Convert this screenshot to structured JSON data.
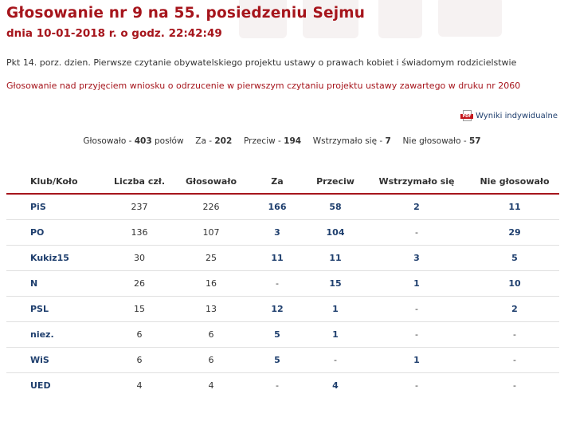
{
  "header": {
    "title": "Głosowanie nr 9 na 55. posiedzeniu Sejmu",
    "subtitle": "dnia 10-01-2018 r. o godz. 22:42:49"
  },
  "agenda": "Pkt 14. porz. dzien. Pierwsze czytanie obywatelskiego projektu ustawy o prawach kobiet i świadomym rodzicielstwie",
  "motion": "Głosowanie nad przyjęciem wniosku o odrzucenie w pierwszym czytaniu projektu ustawy zawartego w druku nr 2060",
  "individual_results": {
    "icon": "pdf-icon",
    "icon_text": "PDF",
    "label": "Wyniki indywidualne"
  },
  "summary": {
    "voted_label": "Głosowało -",
    "voted_value": "403",
    "voted_unit": "posłów",
    "za_label": "Za -",
    "za_value": "202",
    "przeciw_label": "Przeciw -",
    "przeciw_value": "194",
    "wstrz_label": "Wstrzymało się -",
    "wstrz_value": "7",
    "nieg_label": "Nie głosowało -",
    "nieg_value": "57"
  },
  "table": {
    "columns": [
      "Klub/Koło",
      "Liczba czł.",
      "Głosowało",
      "Za",
      "Przeciw",
      "Wstrzymało się",
      "Nie głosowało"
    ],
    "rows": [
      {
        "club": "PiS",
        "members": "237",
        "voted": "226",
        "za": "166",
        "przeciw": "58",
        "wstrz": "2",
        "nieg": "11"
      },
      {
        "club": "PO",
        "members": "136",
        "voted": "107",
        "za": "3",
        "przeciw": "104",
        "wstrz": "-",
        "nieg": "29"
      },
      {
        "club": "Kukiz15",
        "members": "30",
        "voted": "25",
        "za": "11",
        "przeciw": "11",
        "wstrz": "3",
        "nieg": "5"
      },
      {
        "club": "N",
        "members": "26",
        "voted": "16",
        "za": "-",
        "przeciw": "15",
        "wstrz": "1",
        "nieg": "10"
      },
      {
        "club": "PSL",
        "members": "15",
        "voted": "13",
        "za": "12",
        "przeciw": "1",
        "wstrz": "-",
        "nieg": "2"
      },
      {
        "club": "niez.",
        "members": "6",
        "voted": "6",
        "za": "5",
        "przeciw": "1",
        "wstrz": "-",
        "nieg": "-"
      },
      {
        "club": "WiS",
        "members": "6",
        "voted": "6",
        "za": "5",
        "przeciw": "-",
        "wstrz": "1",
        "nieg": "-"
      },
      {
        "club": "UED",
        "members": "4",
        "voted": "4",
        "za": "-",
        "przeciw": "4",
        "wstrz": "-",
        "nieg": "-"
      }
    ]
  },
  "colors": {
    "accent": "#a6151c",
    "link": "#1f3f6e",
    "text": "#333333"
  }
}
